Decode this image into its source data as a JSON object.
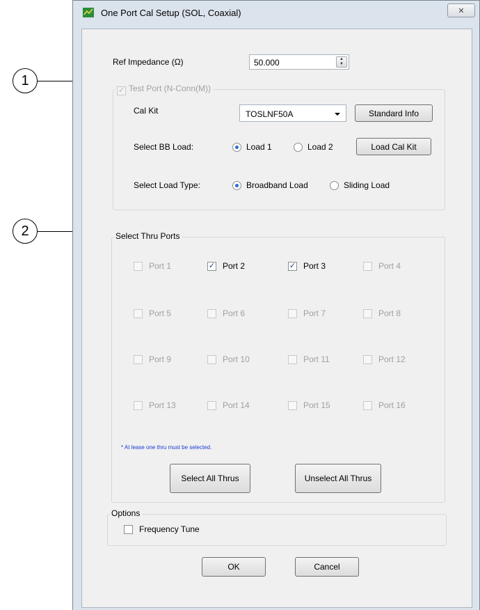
{
  "callouts": [
    "1",
    "2"
  ],
  "window": {
    "title": "One Port Cal Setup (SOL, Coaxial)",
    "close_glyph": "✕"
  },
  "ref_impedance": {
    "label": "Ref Impedance (Ω)",
    "value": "50.000"
  },
  "test_port": {
    "title": "Test Port (N-Conn(M))",
    "cal_kit_label": "Cal Kit",
    "cal_kit_value": "TOSLNF50A",
    "standard_info_button": "Standard Info",
    "select_bb_load_label": "Select BB Load:",
    "load1_label": "Load 1",
    "load2_label": "Load 2",
    "load_cal_kit_button": "Load Cal Kit",
    "select_load_type_label": "Select Load Type:",
    "broadband_label": "Broadband Load",
    "sliding_label": "Sliding Load",
    "selected_load": "Load 1",
    "selected_load_type": "Broadband Load"
  },
  "thru_ports": {
    "title": "Select Thru Ports",
    "ports": [
      {
        "label": "Port 1",
        "checked": false,
        "enabled": false
      },
      {
        "label": "Port 2",
        "checked": true,
        "enabled": true
      },
      {
        "label": "Port 3",
        "checked": true,
        "enabled": true
      },
      {
        "label": "Port 4",
        "checked": false,
        "enabled": false
      },
      {
        "label": "Port 5",
        "checked": false,
        "enabled": false
      },
      {
        "label": "Port 6",
        "checked": false,
        "enabled": false
      },
      {
        "label": "Port 7",
        "checked": false,
        "enabled": false
      },
      {
        "label": "Port 8",
        "checked": false,
        "enabled": false
      },
      {
        "label": "Port 9",
        "checked": false,
        "enabled": false
      },
      {
        "label": "Port 10",
        "checked": false,
        "enabled": false
      },
      {
        "label": "Port 11",
        "checked": false,
        "enabled": false
      },
      {
        "label": "Port 12",
        "checked": false,
        "enabled": false
      },
      {
        "label": "Port 13",
        "checked": false,
        "enabled": false
      },
      {
        "label": "Port 14",
        "checked": false,
        "enabled": false
      },
      {
        "label": "Port 15",
        "checked": false,
        "enabled": false
      },
      {
        "label": "Port 16",
        "checked": false,
        "enabled": false
      }
    ],
    "note": "* At lease one thru must be selected.",
    "select_all_button": "Select All Thrus",
    "unselect_all_button": "Unselect All Thrus"
  },
  "options": {
    "title": "Options",
    "frequency_tune_label": "Frequency Tune",
    "frequency_tune_checked": false
  },
  "footer": {
    "ok_button": "OK",
    "cancel_button": "Cancel"
  },
  "colors": {
    "accent": "#2a6fcf",
    "note": "#1a3bd6",
    "window_frame": "#dbe3ec",
    "dialog_bg": "#f0f0f0"
  }
}
